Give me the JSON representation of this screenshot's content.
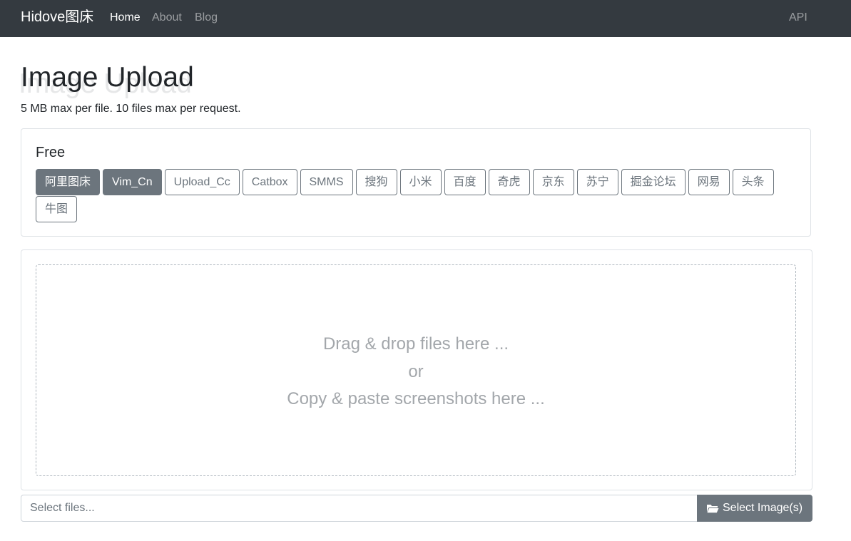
{
  "navbar": {
    "brand": "Hidove图床",
    "links": {
      "home": "Home",
      "about": "About",
      "blog": "Blog",
      "api": "API"
    }
  },
  "page": {
    "title": "Image Upload",
    "subtitle": "5 MB max per file. 10 files max per request."
  },
  "hosts": {
    "group_title": "Free",
    "items": [
      {
        "label": "阿里图床",
        "selected": true
      },
      {
        "label": "Vim_Cn",
        "selected": true
      },
      {
        "label": "Upload_Cc",
        "selected": false
      },
      {
        "label": "Catbox",
        "selected": false
      },
      {
        "label": "SMMS",
        "selected": false
      },
      {
        "label": "搜狗",
        "selected": false
      },
      {
        "label": "小米",
        "selected": false
      },
      {
        "label": "百度",
        "selected": false
      },
      {
        "label": "奇虎",
        "selected": false
      },
      {
        "label": "京东",
        "selected": false
      },
      {
        "label": "苏宁",
        "selected": false
      },
      {
        "label": "掘金论坛",
        "selected": false
      },
      {
        "label": "网易",
        "selected": false
      },
      {
        "label": "头条",
        "selected": false
      },
      {
        "label": "牛图",
        "selected": false
      }
    ]
  },
  "dropzone": {
    "line1": "Drag & drop files here ...",
    "line2": "or",
    "line3": "Copy & paste screenshots here ..."
  },
  "file_input": {
    "placeholder": "Select files...",
    "button_label": "Select Image(s)",
    "button_icon": "folder-open-icon"
  },
  "colors": {
    "navbar_bg": "#343a40",
    "secondary": "#6c757d",
    "border": "#dee2e6"
  }
}
